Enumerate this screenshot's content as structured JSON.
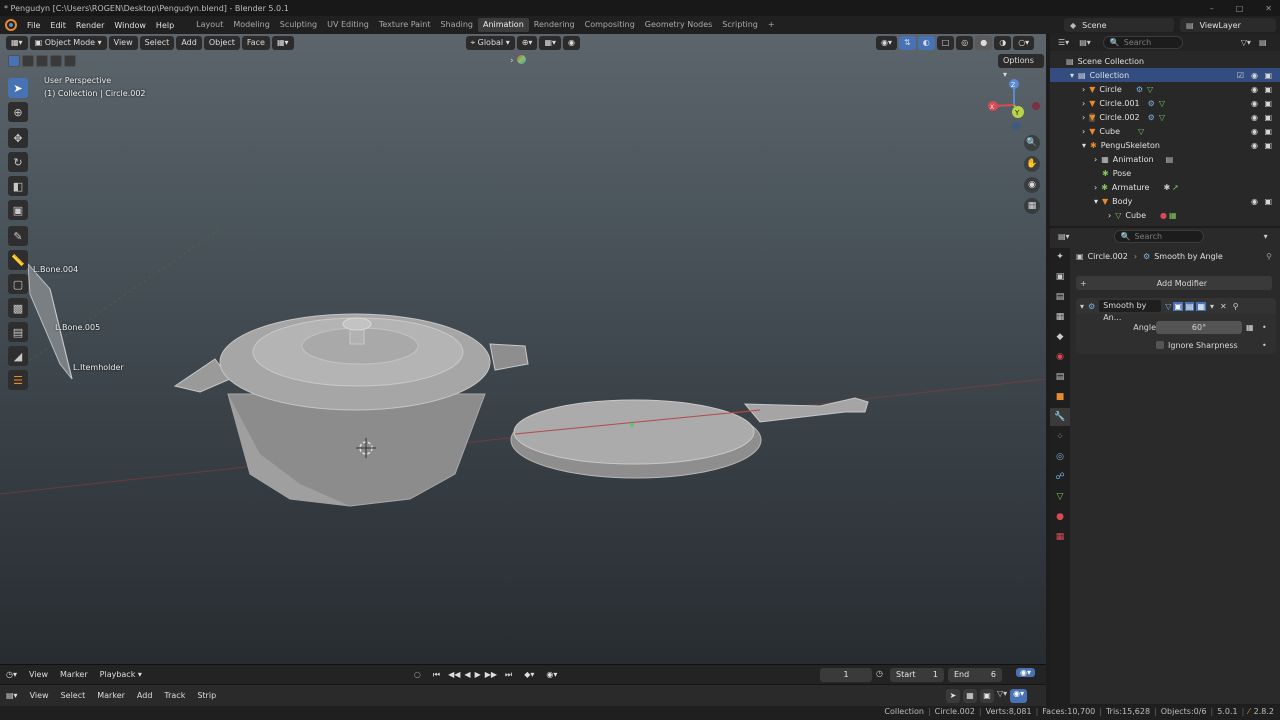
{
  "window": {
    "title": "* Pengudyn [C:\\Users\\ROGEN\\Desktop\\Pengudyn.blend] - Blender 5.0.1",
    "controls": [
      "–",
      "□",
      "✕"
    ]
  },
  "menu": [
    "File",
    "Edit",
    "Render",
    "Window",
    "Help"
  ],
  "workspaces": [
    {
      "label": "Layout"
    },
    {
      "label": "Modeling"
    },
    {
      "label": "Sculpting"
    },
    {
      "label": "UV Editing"
    },
    {
      "label": "Texture Paint"
    },
    {
      "label": "Shading"
    },
    {
      "label": "Animation"
    },
    {
      "label": "Rendering"
    },
    {
      "label": "Compositing"
    },
    {
      "label": "Geometry Nodes"
    },
    {
      "label": "Scripting"
    }
  ],
  "active_workspace": "Animation",
  "add_workspace": "+",
  "scene": {
    "label": "Scene",
    "view_layer": "ViewLayer"
  },
  "viewport": {
    "mode": "Object Mode",
    "menus": [
      "View",
      "Select",
      "Add",
      "Object",
      "Face"
    ],
    "transform_orientation": "Global",
    "options": "Options",
    "overlay_line1": "User Perspective",
    "overlay_line2": "(1) Collection | Circle.002",
    "bone_labels": [
      "L.Bone.004",
      "L.Bone.005",
      "L.Itemholder"
    ],
    "gizmo_axes": {
      "x": "X",
      "y": "Y",
      "z": "Z"
    }
  },
  "timeline": {
    "row1_menus": [
      "View",
      "Marker",
      "Playback"
    ],
    "row2_menus": [
      "View",
      "Select",
      "Marker",
      "Add",
      "Track",
      "Strip"
    ],
    "current_frame": "1",
    "start_label": "Start",
    "start_value": "1",
    "end_label": "End",
    "end_value": "6"
  },
  "outliner": {
    "search_placeholder": "Search",
    "items": [
      {
        "label": "Scene Collection"
      },
      {
        "label": "Collection"
      },
      {
        "label": "Circle"
      },
      {
        "label": "Circle.001"
      },
      {
        "label": "Circle.002"
      },
      {
        "label": "Cube"
      },
      {
        "label": "PenguSkeleton"
      },
      {
        "label": "Animation"
      },
      {
        "label": "Pose"
      },
      {
        "label": "Armature"
      },
      {
        "label": "Body"
      },
      {
        "label": "Cube"
      }
    ]
  },
  "properties": {
    "search_placeholder": "Search",
    "breadcrumb_object": "Circle.002",
    "breadcrumb_modifier": "Smooth by Angle",
    "add_modifier": "Add Modifier",
    "modifier_name": "Smooth by An...",
    "angle_label": "Angle",
    "angle_value": "60°",
    "ignore_sharpness": "Ignore Sharpness"
  },
  "statusbar": {
    "collection": "Collection",
    "object": "Circle.002",
    "verts": "Verts:8,081",
    "faces": "Faces:10,700",
    "tris": "Tris:15,628",
    "objects": "Objects:0/6",
    "version": "5.0.1",
    "extra": "2.8.2"
  },
  "colors": {
    "accent": "#4772b3",
    "object_orange": "#e88b2d",
    "mesh_green": "#7fc65e",
    "selection_blue": "#334d80"
  }
}
